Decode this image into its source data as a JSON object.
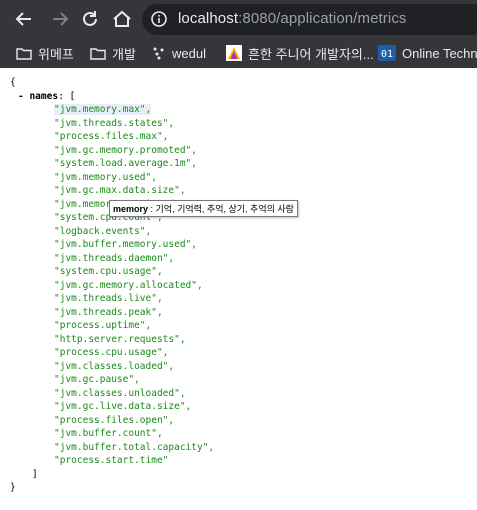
{
  "browser": {
    "url_host": "localhost",
    "url_rest": ":8080/application/metrics"
  },
  "bookmarks": [
    {
      "label": "위메프",
      "icon": "folder-icon"
    },
    {
      "label": "개발",
      "icon": "folder-icon"
    },
    {
      "label": "wedul",
      "icon": "dots-icon"
    },
    {
      "label": "흔한 주니어 개발자의...",
      "icon": "triangle-logo-icon"
    },
    {
      "label": "Online Techn",
      "icon": "badge-01-icon"
    }
  ],
  "json": {
    "open_brace": "{",
    "collapse": "- ",
    "key": "names",
    "colon_bracket": ": [",
    "items": [
      "\"jvm.memory.max\",",
      "\"jvm.threads.states\",",
      "\"process.files.max\",",
      "\"jvm.gc.memory.promoted\",",
      "\"system.load.average.1m\",",
      "\"jvm.memory.used\",",
      "\"jvm.gc.max.data.size\",",
      "\"jvm.memory.committed\",",
      "\"system.cpu.count\",",
      "\"logback.events\",",
      "\"jvm.buffer.memory.used\",",
      "\"jvm.threads.daemon\",",
      "\"system.cpu.usage\",",
      "\"jvm.gc.memory.allocated\",",
      "\"jvm.threads.live\",",
      "\"jvm.threads.peak\",",
      "\"process.uptime\",",
      "\"http.server.requests\",",
      "\"process.cpu.usage\",",
      "\"jvm.classes.loaded\",",
      "\"jvm.gc.pause\",",
      "\"jvm.classes.unloaded\",",
      "\"jvm.gc.live.data.size\",",
      "\"process.files.open\",",
      "\"jvm.buffer.count\",",
      "\"jvm.buffer.total.capacity\",",
      "\"process.start.time\""
    ],
    "close_bracket": "]",
    "close_brace": "}"
  },
  "tooltip": {
    "term": "memory",
    "definition": " : 기억, 기억력, 추억, 상기, 추억의 사람"
  }
}
